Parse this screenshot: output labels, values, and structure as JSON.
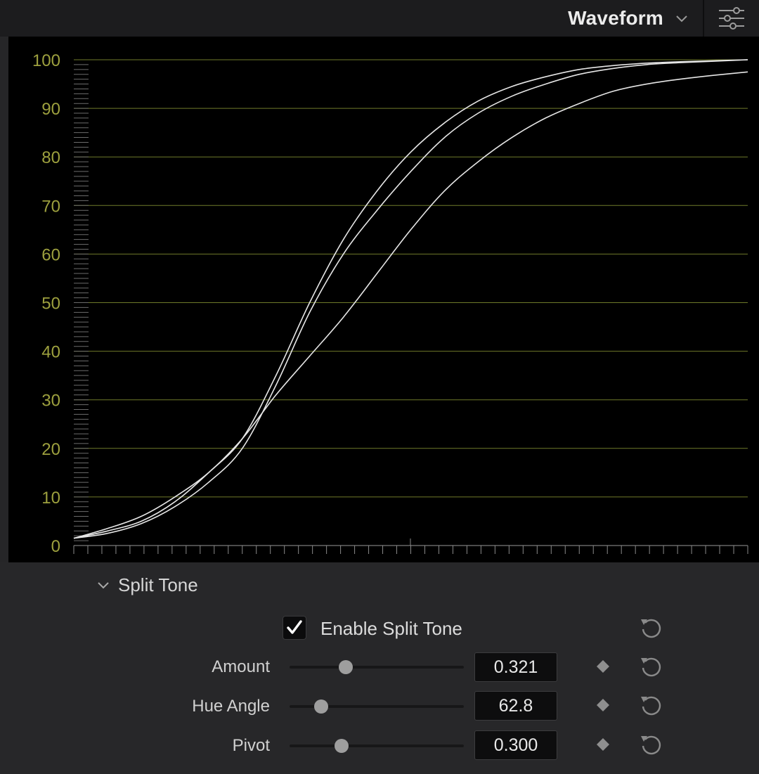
{
  "header": {
    "scope_mode": "Waveform",
    "dropdown_icon": "chevron-down-icon",
    "options_icon": "sliders-icon"
  },
  "chart_data": {
    "type": "line",
    "y_ticks": [
      "100",
      "90",
      "80",
      "70",
      "60",
      "50",
      "40",
      "30",
      "20",
      "10",
      "0"
    ],
    "ylim": [
      0,
      100
    ],
    "grid": true,
    "grid_color": "#6f7a2a",
    "tick_label_color": "#9da03e",
    "trace_color": "#e6e6e6",
    "x": [
      0,
      5,
      10,
      15,
      20,
      25,
      30,
      35,
      40,
      45,
      50,
      55,
      60,
      65,
      70,
      75,
      80,
      85,
      90,
      95,
      100
    ],
    "series": [
      {
        "values": [
          1.5,
          3,
          5,
          9,
          15,
          22,
          35,
          50,
          63,
          73,
          81,
          87,
          91.5,
          94.5,
          96.5,
          98,
          98.8,
          99.3,
          99.6,
          99.8,
          100
        ]
      },
      {
        "values": [
          1.5,
          2.5,
          4.5,
          8,
          13,
          20,
          33,
          48,
          60,
          69,
          77,
          84,
          89,
          92.5,
          95,
          97,
          98.2,
          99,
          99.4,
          99.7,
          100
        ]
      },
      {
        "values": [
          1.5,
          3.5,
          6,
          10,
          15,
          22,
          31,
          39,
          47,
          56,
          65,
          73,
          79,
          84,
          88,
          91,
          93.5,
          95,
          96,
          96.8,
          97.5
        ]
      }
    ]
  },
  "split_tone": {
    "section_title": "Split Tone",
    "section_icon": "chevron-down-icon",
    "enable_label": "Enable Split Tone",
    "enabled": true,
    "rows": [
      {
        "label": "Amount",
        "value": "0.321",
        "slider_fraction": 0.321
      },
      {
        "label": "Hue Angle",
        "value": "62.8",
        "slider_fraction": 0.18
      },
      {
        "label": "Pivot",
        "value": "0.300",
        "slider_fraction": 0.3
      }
    ]
  }
}
